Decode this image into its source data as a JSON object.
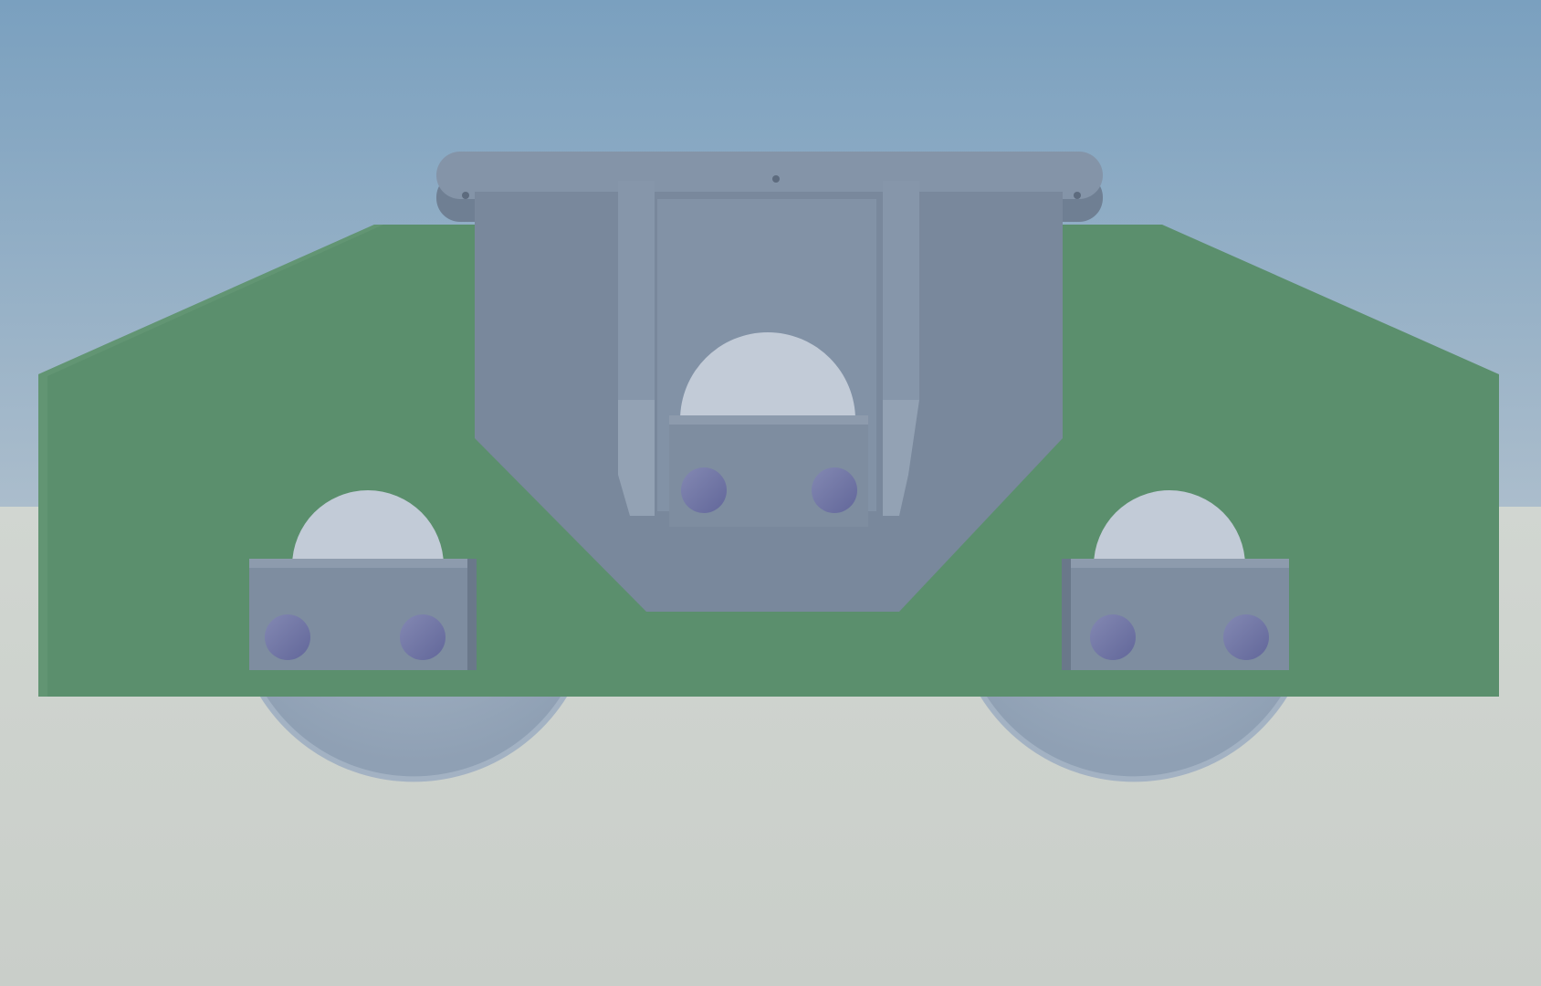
{
  "scene": {
    "subject": "bogie-render",
    "colors": {
      "sky_top": "#7fa3c1",
      "sky_bottom": "#a9bccc",
      "ground": "#cdd2cd",
      "frame_green": "#5a8e6c",
      "bracket_grey": "#78879b",
      "plate_grey": "#7d8ea3",
      "wheel_grey": "#98a9bc",
      "axle_grey": "#c1cad6",
      "bearing_box": "#7b8a9c",
      "bolt": "#6f749f"
    },
    "parts": {
      "wheel_count": 2,
      "axle_box_count": 3,
      "bolt_count": 6
    }
  }
}
